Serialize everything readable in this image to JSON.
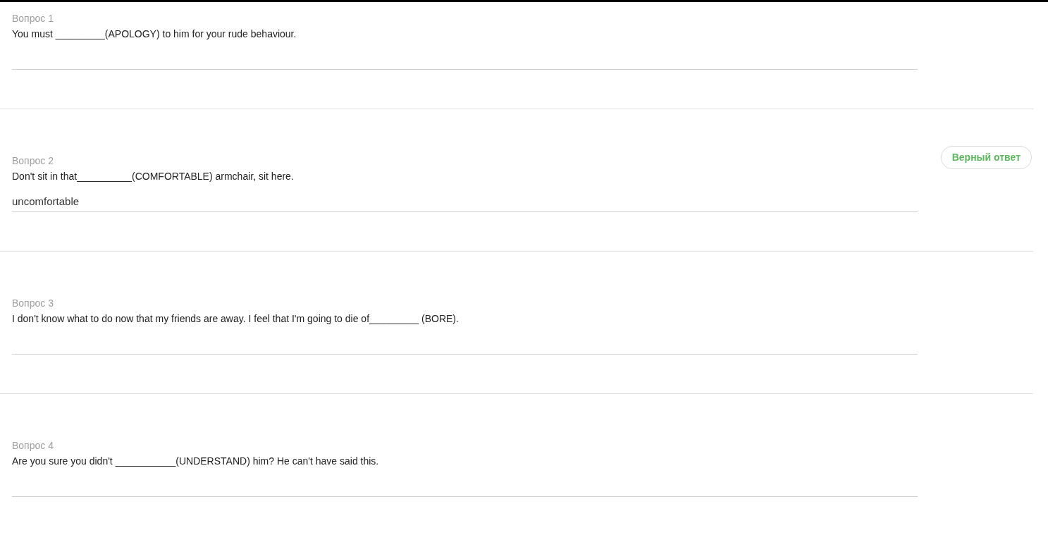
{
  "questions": [
    {
      "label": "Вопрос 1",
      "text": "You must _________(APOLOGY) to him for your rude behaviour."
    },
    {
      "label": "Вопрос 2",
      "text": "Don't sit in that__________(COMFORTABLE) armchair, sit here.",
      "answer": "uncomfortable",
      "result": {
        "label": "Верный ответ",
        "kind": "correct"
      }
    },
    {
      "label": "Вопрос 3",
      "text": "I don't know what to do now that my friends are away. I feel that I'm going to die of_________ (BORE)."
    },
    {
      "label": "Вопрос 4",
      "text": "Are you sure you didn't ___________(UNDERSTAND) him? He can't have said this."
    }
  ]
}
